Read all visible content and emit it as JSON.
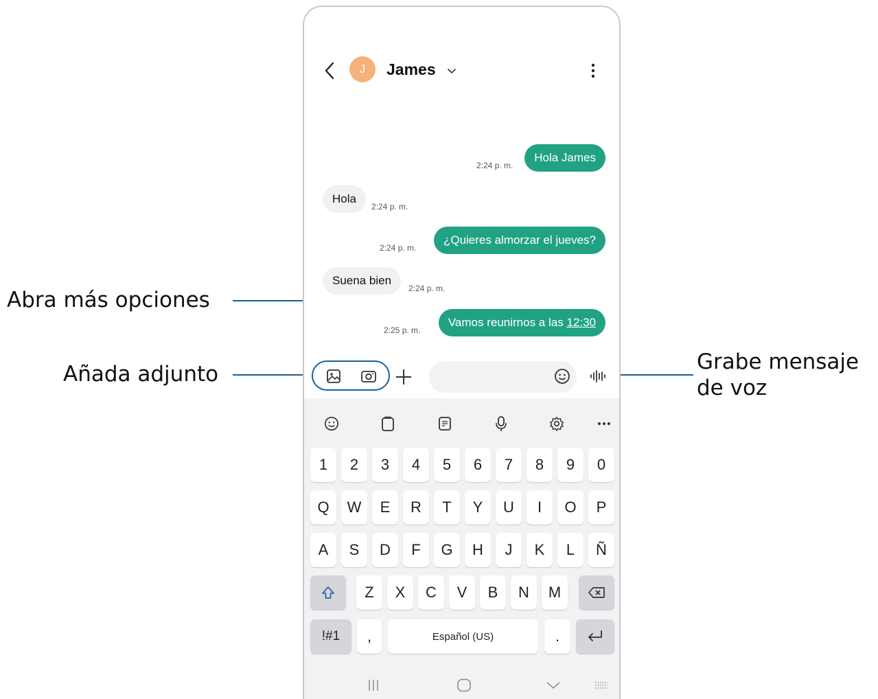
{
  "callouts": {
    "more_options": "Abra más opciones",
    "attachment": "Añada adjunto",
    "voice_line1": "Grabe mensaje",
    "voice_line2": "de voz"
  },
  "header": {
    "avatar_initial": "J",
    "contact_name": "James",
    "back_icon": "back-icon",
    "dropdown_icon": "chevron-down-icon",
    "menu_icon": "more-vertical-icon"
  },
  "messages": [
    {
      "direction": "out",
      "text": "Hola James",
      "time": "2:24 p. m."
    },
    {
      "direction": "in",
      "text": "Hola",
      "time": "2:24 p. m."
    },
    {
      "direction": "out",
      "text": "¿Quieres almorzar el jueves?",
      "time": "2:24 p. m."
    },
    {
      "direction": "in",
      "text": "Suena bien",
      "time": "2:24 p. m."
    },
    {
      "direction": "out",
      "text_prefix": "Vamos reunirnos a las ",
      "text_link": "12:30",
      "time": "2:25 p. m."
    }
  ],
  "composer": {
    "placeholder": "",
    "gallery_icon": "gallery-icon",
    "camera_icon": "camera-icon",
    "plus_icon": "plus-icon",
    "emoji_icon": "emoji-icon",
    "voice_icon": "voice-waveform-icon"
  },
  "keyboard": {
    "toolbar": [
      "emoji-icon",
      "clipboard-icon",
      "keyboard-mode-icon",
      "mic-icon",
      "settings-icon",
      "more-horizontal-icon"
    ],
    "row_numbers": [
      "1",
      "2",
      "3",
      "4",
      "5",
      "6",
      "7",
      "8",
      "9",
      "0"
    ],
    "row1": [
      "Q",
      "W",
      "E",
      "R",
      "T",
      "Y",
      "U",
      "I",
      "O",
      "P"
    ],
    "row2": [
      "A",
      "S",
      "D",
      "F",
      "G",
      "H",
      "J",
      "K",
      "L",
      "Ñ"
    ],
    "row3": [
      "Z",
      "X",
      "C",
      "V",
      "B",
      "N",
      "M"
    ],
    "symbols_key": "!#1",
    "comma_key": ",",
    "space_label": "Español (US)",
    "period_key": ".",
    "shift_icon": "shift-icon",
    "backspace_icon": "backspace-icon",
    "enter_icon": "enter-icon"
  },
  "navbar": [
    "recents-icon",
    "home-icon",
    "hide-keyboard-icon",
    "keyboard-switch-icon"
  ],
  "colors": {
    "accent": "#21a383",
    "callout_line": "#1a5f96",
    "avatar": "#f4b27a"
  }
}
